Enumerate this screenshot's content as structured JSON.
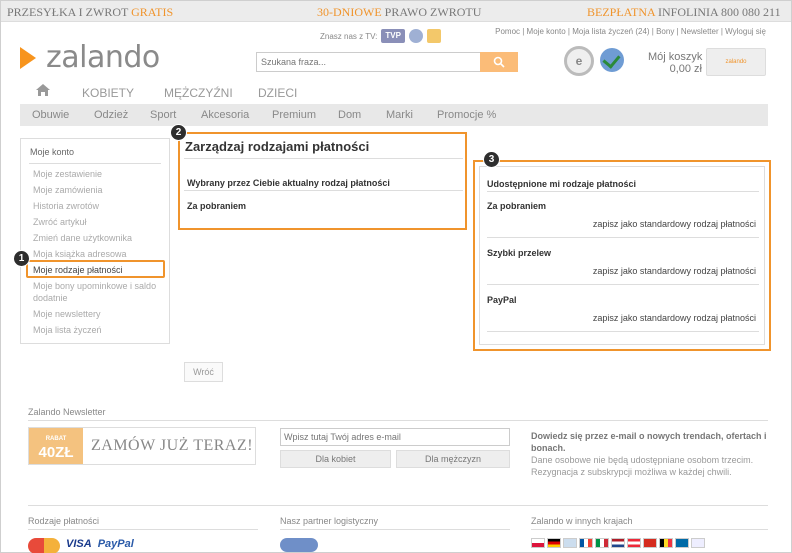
{
  "topbar": {
    "shipping": "PRZESYŁKA I ZWROT",
    "shipping_free": "GRATIS",
    "return_days": "30-DNIOWE",
    "return_text": "PRAWO ZWROTU",
    "hotline_free": "BEZPŁATNA",
    "hotline_text": "INFOLINIA 800 080 211"
  },
  "brand": "zalando",
  "tv": {
    "label": "Znasz nas z TV:",
    "channel": "TVP"
  },
  "toplinks": "Pomoc | Moje konto | Moja lista życzeń (24) | Bony | Newsletter | Wyloguj się",
  "search": {
    "placeholder": "Szukana fraza..."
  },
  "cart": {
    "label": "Mój koszyk (0)",
    "amount": "0,00 zł",
    "product": "zalando"
  },
  "nav_main": [
    "KOBIETY",
    "MĘŻCZYŹNI",
    "DZIECI"
  ],
  "nav_sub": [
    "Obuwie",
    "Odzież",
    "Sport",
    "Akcesoria",
    "Premium",
    "Dom",
    "Marki",
    "Promocje %"
  ],
  "sidebar": {
    "title": "Moje konto",
    "items": [
      "Moje zestawienie",
      "Moje zamówienia",
      "Historia zwrotów",
      "Zwróć artykuł",
      "Zmień dane użytkownika",
      "Moja książka adresowa",
      "Moje rodzaje płatności",
      "Moje bony upominkowe i saldo",
      "dodatnie",
      "Moje newslettery",
      "Moja lista życzeń"
    ]
  },
  "steps": [
    "1",
    "2",
    "3"
  ],
  "main": {
    "title": "Zarządzaj rodzajami płatności",
    "current_header": "Wybrany przez Ciebie aktualny rodzaj płatności",
    "current_value": "Za pobraniem"
  },
  "shared": {
    "header": "Udostępnione mi rodzaje płatności",
    "methods": [
      {
        "name": "Za pobraniem",
        "action": "zapisz jako standardowy rodzaj płatności"
      },
      {
        "name": "Szybki przelew",
        "action": "zapisz jako standardowy rodzaj płatności"
      },
      {
        "name": "PayPal",
        "action": "zapisz jako standardowy rodzaj płatności"
      }
    ]
  },
  "back_button": "Wróć",
  "newsletter": {
    "title": "Zalando Newsletter",
    "rabat_small": "RABAT",
    "rabat_value": "40ZŁ",
    "banner_text": "ZAMÓW JUŻ TERAZ!",
    "email_placeholder": "Wpisz tutaj Twój adres e-mail",
    "women_button": "Dla kobiet",
    "men_button": "Dla mężczyzn",
    "info_bold": "Dowiedz się przez e-mail o nowych trendach, ofertach i bonach.",
    "info_1": "Dane osobowe nie będą udostępniane osobom trzecim.",
    "info_2": "Rezygnacja z subskrypcji możliwa w każdej chwili."
  },
  "footer": {
    "payments_title": "Rodzaje płatności",
    "partner_title": "Nasz partner logistyczny",
    "countries_title": "Zalando w innych krajach",
    "pay_visa": "VISA",
    "pay_paypal": "PayPal"
  }
}
